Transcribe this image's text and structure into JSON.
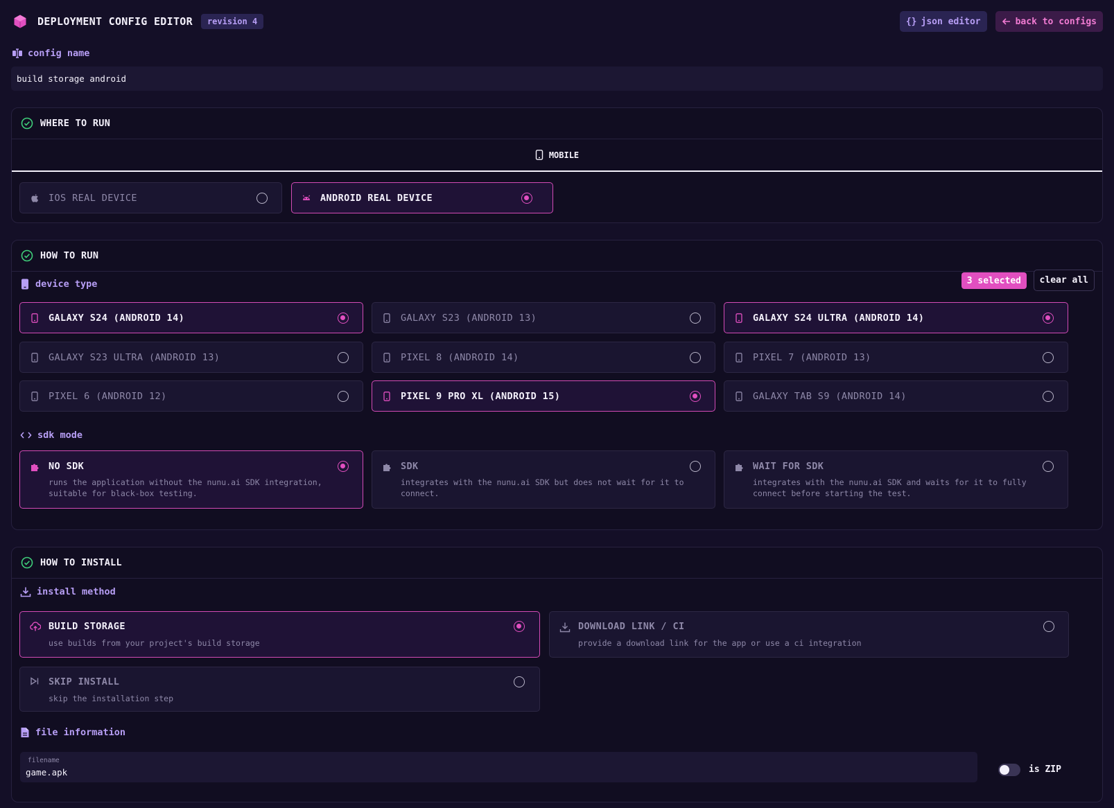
{
  "header": {
    "title": "DEPLOYMENT CONFIG EDITOR",
    "revision": "revision 4",
    "json_editor": "json editor",
    "back": "back to configs"
  },
  "config_name": {
    "label": "config name",
    "value": "build storage android"
  },
  "where": {
    "title": "WHERE TO RUN",
    "tab": "MOBILE",
    "options": [
      {
        "label": "IOS REAL DEVICE",
        "selected": false,
        "icon": "apple-icon"
      },
      {
        "label": "ANDROID REAL DEVICE",
        "selected": true,
        "icon": "android-icon"
      }
    ]
  },
  "how": {
    "title": "HOW TO RUN",
    "device_label": "device type",
    "selected_count": "3 selected",
    "clear_all": "clear all",
    "devices": [
      {
        "label": "GALAXY S24 (ANDROID 14)",
        "selected": true
      },
      {
        "label": "GALAXY S23 (ANDROID 13)",
        "selected": false
      },
      {
        "label": "GALAXY S24 ULTRA (ANDROID 14)",
        "selected": true
      },
      {
        "label": "GALAXY S23 ULTRA (ANDROID 13)",
        "selected": false
      },
      {
        "label": "PIXEL 8 (ANDROID 14)",
        "selected": false
      },
      {
        "label": "PIXEL 7 (ANDROID 13)",
        "selected": false
      },
      {
        "label": "PIXEL 6 (ANDROID 12)",
        "selected": false
      },
      {
        "label": "PIXEL 9 PRO XL (ANDROID 15)",
        "selected": true
      },
      {
        "label": "GALAXY TAB S9 (ANDROID 14)",
        "selected": false
      }
    ],
    "sdk_label": "sdk mode",
    "sdk_modes": [
      {
        "label": "NO SDK",
        "desc1": "runs the application without the nunu.ai SDK integration,",
        "desc2": "suitable for black-box testing.",
        "selected": true
      },
      {
        "label": "SDK",
        "desc1": "integrates with the nunu.ai SDK but does not wait for it to",
        "desc2": "connect.",
        "selected": false
      },
      {
        "label": "WAIT FOR SDK",
        "desc1": "integrates with the nunu.ai SDK and waits for it to fully",
        "desc2": "connect before starting the test.",
        "selected": false
      }
    ]
  },
  "install": {
    "title": "HOW TO INSTALL",
    "method_label": "install method",
    "methods": [
      {
        "label": "BUILD STORAGE",
        "desc": "use builds from your project's build storage",
        "selected": true,
        "icon": "cloud-upload-icon"
      },
      {
        "label": "DOWNLOAD LINK / CI",
        "desc": "provide a download link for the app or use a ci integration",
        "selected": false,
        "icon": "download-icon"
      },
      {
        "label": "SKIP INSTALL",
        "desc": "skip the installation step",
        "selected": false,
        "icon": "skip-forward-icon"
      }
    ],
    "file_label": "file information",
    "filename_label": "filename",
    "filename": "game.apk",
    "zip_label": "is ZIP",
    "is_zip": false
  },
  "colors": {
    "accent": "#e14fc0",
    "label": "#b79ef5",
    "success": "#3fcf7a",
    "background": "#140f27"
  }
}
